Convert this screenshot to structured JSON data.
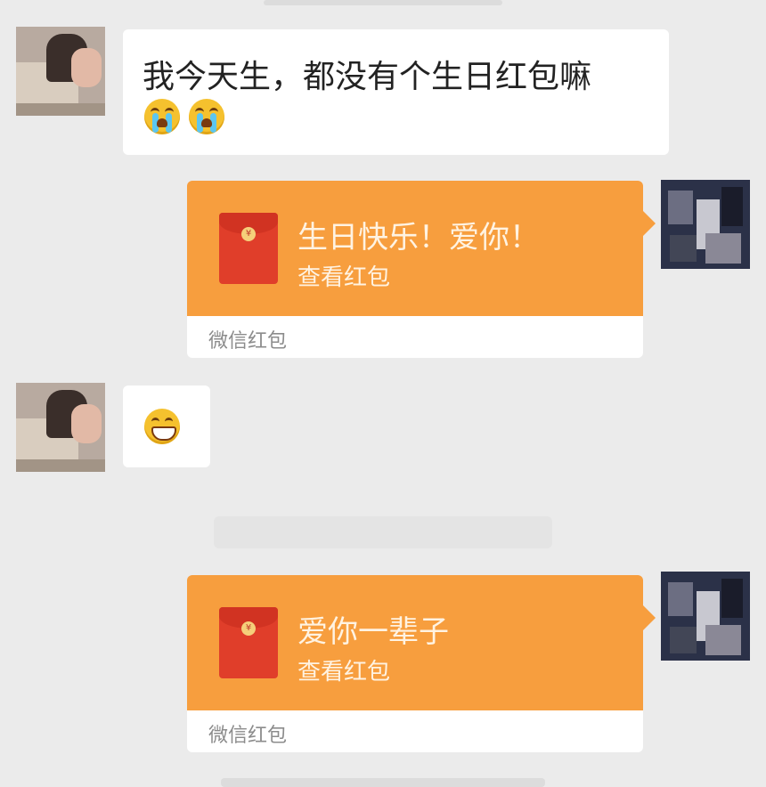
{
  "chat": {
    "messages": [
      {
        "type": "text",
        "from": "other",
        "text": "我今天生，都没有个生日红包嘛",
        "emojis": [
          "crying-emoji",
          "crying-emoji"
        ]
      },
      {
        "type": "red_packet",
        "from": "self",
        "title": "生日快乐！爱你！",
        "action": "查看红包",
        "footer": "微信红包"
      },
      {
        "type": "emoji",
        "from": "other",
        "emojis": [
          "grinning-emoji"
        ]
      },
      {
        "type": "red_packet",
        "from": "self",
        "title": "爱你一辈子",
        "action": "查看红包",
        "footer": "微信红包"
      }
    ]
  },
  "colors": {
    "background": "#ebebeb",
    "red_packet_orange": "#f79e3e",
    "red_packet_envelope": "#e03e2a",
    "bubble_white": "#ffffff"
  },
  "icons": {
    "envelope": "red-envelope-icon",
    "coin_symbol": "¥"
  }
}
